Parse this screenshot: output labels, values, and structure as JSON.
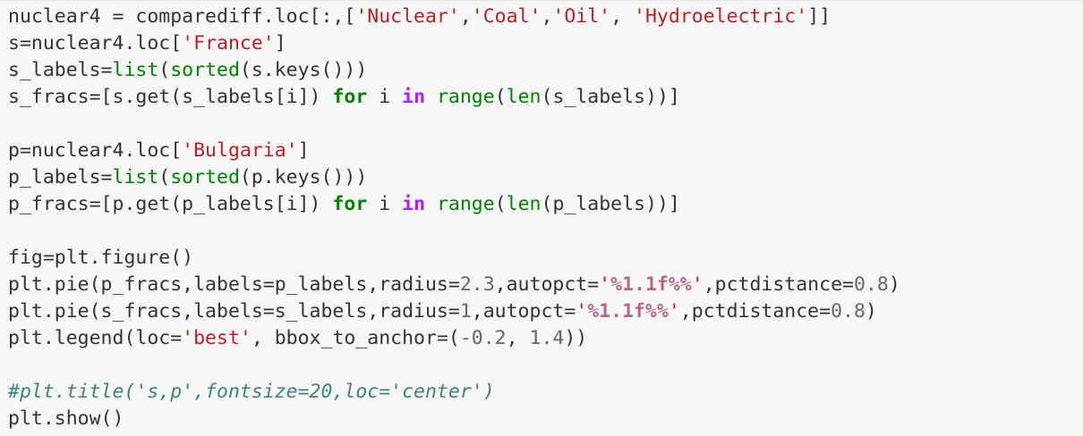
{
  "colors": {
    "background": "#f7f7f7",
    "text": "#333333",
    "string": "#ba2121",
    "number": "#666666",
    "builtin": "#008000",
    "keyword": "#008000",
    "operator_keyword": "#aa22ff",
    "format_specifier": "#bb6688",
    "comment": "#408080"
  },
  "lines": [
    [
      {
        "t": "nuclear4 = comparediff.loc[:,[",
        "c": "txt"
      },
      {
        "t": "'Nuclear'",
        "c": "str"
      },
      {
        "t": ",",
        "c": "txt"
      },
      {
        "t": "'Coal'",
        "c": "str"
      },
      {
        "t": ",",
        "c": "txt"
      },
      {
        "t": "'Oil'",
        "c": "str"
      },
      {
        "t": ", ",
        "c": "txt"
      },
      {
        "t": "'Hydroelectric'",
        "c": "str"
      },
      {
        "t": "]]",
        "c": "txt"
      }
    ],
    [
      {
        "t": "s=nuclear4.loc[",
        "c": "txt"
      },
      {
        "t": "'France'",
        "c": "str"
      },
      {
        "t": "]",
        "c": "txt"
      }
    ],
    [
      {
        "t": "s_labels=",
        "c": "txt"
      },
      {
        "t": "list",
        "c": "bi"
      },
      {
        "t": "(",
        "c": "txt"
      },
      {
        "t": "sorted",
        "c": "bi"
      },
      {
        "t": "(s.keys()))",
        "c": "txt"
      }
    ],
    [
      {
        "t": "s_fracs=[s.get(s_labels[i]) ",
        "c": "txt"
      },
      {
        "t": "for",
        "c": "kw"
      },
      {
        "t": " i ",
        "c": "txt"
      },
      {
        "t": "in",
        "c": "op"
      },
      {
        "t": " ",
        "c": "txt"
      },
      {
        "t": "range",
        "c": "bi"
      },
      {
        "t": "(",
        "c": "txt"
      },
      {
        "t": "len",
        "c": "bi"
      },
      {
        "t": "(s_labels))]",
        "c": "txt"
      }
    ],
    [],
    [
      {
        "t": "p=nuclear4.loc[",
        "c": "txt"
      },
      {
        "t": "'Bulgaria'",
        "c": "str"
      },
      {
        "t": "]",
        "c": "txt"
      }
    ],
    [
      {
        "t": "p_labels=",
        "c": "txt"
      },
      {
        "t": "list",
        "c": "bi"
      },
      {
        "t": "(",
        "c": "txt"
      },
      {
        "t": "sorted",
        "c": "bi"
      },
      {
        "t": "(p.keys()))",
        "c": "txt"
      }
    ],
    [
      {
        "t": "p_fracs=[p.get(p_labels[i]) ",
        "c": "txt"
      },
      {
        "t": "for",
        "c": "kw"
      },
      {
        "t": " i ",
        "c": "txt"
      },
      {
        "t": "in",
        "c": "op"
      },
      {
        "t": " ",
        "c": "txt"
      },
      {
        "t": "range",
        "c": "bi"
      },
      {
        "t": "(",
        "c": "txt"
      },
      {
        "t": "len",
        "c": "bi"
      },
      {
        "t": "(p_labels))]",
        "c": "txt"
      }
    ],
    [],
    [
      {
        "t": "fig=plt.figure()",
        "c": "txt"
      }
    ],
    [
      {
        "t": "plt.pie(p_fracs,labels=p_labels,radius=",
        "c": "txt"
      },
      {
        "t": "2.3",
        "c": "num"
      },
      {
        "t": ",autopct=",
        "c": "txt"
      },
      {
        "t": "'",
        "c": "str"
      },
      {
        "t": "%1.1f%%",
        "c": "fmt"
      },
      {
        "t": "'",
        "c": "str"
      },
      {
        "t": ",pctdistance=",
        "c": "txt"
      },
      {
        "t": "0.8",
        "c": "num"
      },
      {
        "t": ")",
        "c": "txt"
      }
    ],
    [
      {
        "t": "plt.pie(s_fracs,labels=s_labels,radius=",
        "c": "txt"
      },
      {
        "t": "1",
        "c": "num"
      },
      {
        "t": ",autopct=",
        "c": "txt"
      },
      {
        "t": "'",
        "c": "str"
      },
      {
        "t": "%1.1f%%",
        "c": "fmt"
      },
      {
        "t": "'",
        "c": "str"
      },
      {
        "t": ",pctdistance=",
        "c": "txt"
      },
      {
        "t": "0.8",
        "c": "num"
      },
      {
        "t": ")",
        "c": "txt"
      }
    ],
    [
      {
        "t": "plt.legend(loc=",
        "c": "txt"
      },
      {
        "t": "'best'",
        "c": "str"
      },
      {
        "t": ", bbox_to_anchor=(",
        "c": "txt"
      },
      {
        "t": "-0.2",
        "c": "num"
      },
      {
        "t": ", ",
        "c": "txt"
      },
      {
        "t": "1.4",
        "c": "num"
      },
      {
        "t": "))",
        "c": "txt"
      }
    ],
    [],
    [
      {
        "t": "#plt.title('s,p',fontsize=20,loc='center')",
        "c": "cm"
      }
    ],
    [
      {
        "t": "plt.show()",
        "c": "txt"
      }
    ]
  ]
}
